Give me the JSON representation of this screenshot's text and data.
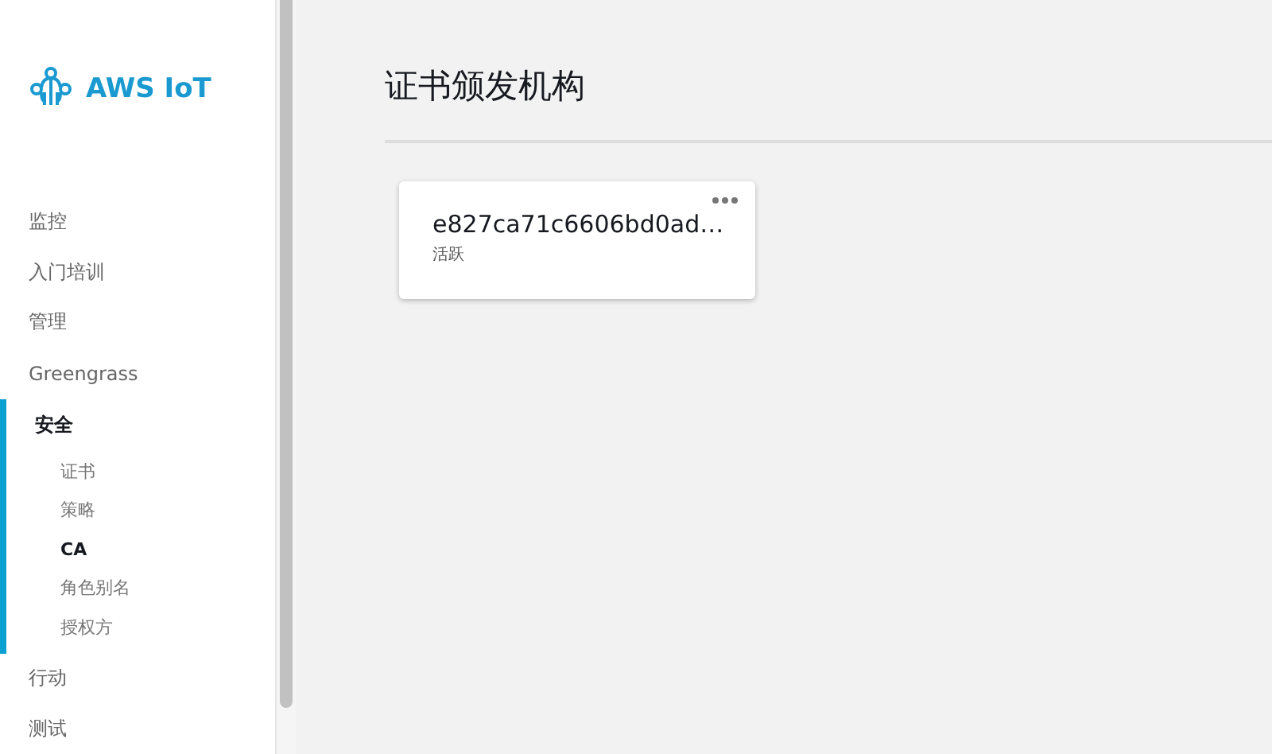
{
  "sidebar": {
    "logo": "AWS IoT",
    "items": [
      {
        "label": "监控",
        "selected": false,
        "expanded": false
      },
      {
        "label": "入门培训",
        "selected": false,
        "expanded": false
      },
      {
        "label": "管理",
        "selected": false,
        "expanded": false
      },
      {
        "label": "Greengrass",
        "selected": false,
        "expanded": false
      },
      {
        "label": "安全",
        "selected": true,
        "expanded": true,
        "children": [
          {
            "label": "证书",
            "selected": false
          },
          {
            "label": "策略",
            "selected": false
          },
          {
            "label": "CA",
            "selected": true
          },
          {
            "label": "角色别名",
            "selected": false
          },
          {
            "label": "授权方",
            "selected": false
          }
        ]
      },
      {
        "label": "行动",
        "selected": false,
        "expanded": false
      },
      {
        "label": "测试",
        "selected": false,
        "expanded": false
      }
    ]
  },
  "page": {
    "title": "证书颁发机构",
    "cards": [
      {
        "title": "e827ca71c6606bd0ad…",
        "status": "活跃"
      }
    ]
  }
}
